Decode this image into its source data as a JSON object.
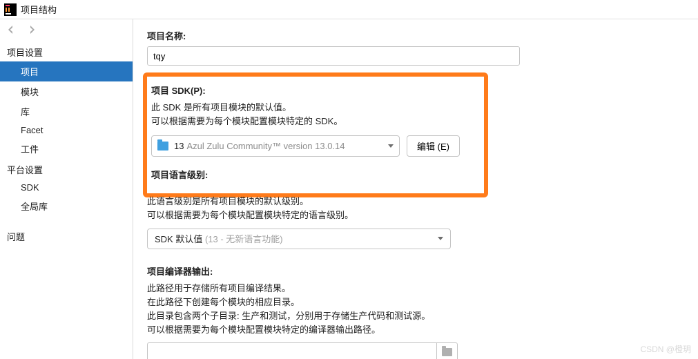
{
  "titlebar": {
    "title": "项目结构"
  },
  "sidebar": {
    "group_project_settings": "项目设置",
    "items_project": [
      {
        "label": "项目"
      },
      {
        "label": "模块"
      },
      {
        "label": "库"
      },
      {
        "label": "Facet"
      },
      {
        "label": "工件"
      }
    ],
    "group_platform_settings": "平台设置",
    "items_platform": [
      {
        "label": "SDK"
      },
      {
        "label": "全局库"
      }
    ],
    "problems": "问题"
  },
  "main": {
    "name_label": "项目名称:",
    "name_value": "tqy",
    "sdk_label": "项目 SDK(P):",
    "sdk_desc_1": "此 SDK 是所有项目模块的默认值。",
    "sdk_desc_2": "可以根据需要为每个模块配置模块特定的 SDK。",
    "sdk_selected_num": "13",
    "sdk_selected_rest": "Azul Zulu Community™ version 13.0.14",
    "edit_button": "编辑 (E)",
    "lang_label": "项目语言级别:",
    "lang_desc_1": "此语言级别是所有项目模块的默认级别。",
    "lang_desc_2": "可以根据需要为每个模块配置模块特定的语言级别。",
    "lang_selected": "SDK 默认值",
    "lang_hint": " (13 - 无新语言功能)",
    "output_label": "项目编译器输出:",
    "output_desc_1": "此路径用于存储所有项目编译结果。",
    "output_desc_2": "在此路径下创建每个模块的相应目录。",
    "output_desc_3": "此目录包含两个子目录: 生产和测试，分别用于存储生产代码和测试源。",
    "output_desc_4": "可以根据需要为每个模块配置模块特定的编译器输出路径。",
    "output_value": ""
  },
  "watermark": "CSDN @橙玥"
}
